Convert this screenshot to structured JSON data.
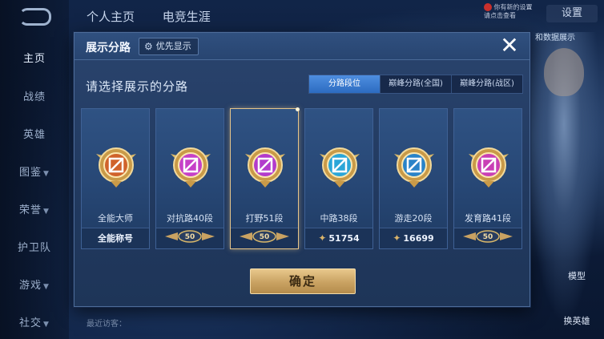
{
  "background": {
    "nav": [
      {
        "label": "主页",
        "active": true
      },
      {
        "label": "战绩",
        "active": false
      },
      {
        "label": "英雄",
        "active": false
      },
      {
        "label": "图鉴",
        "active": false
      },
      {
        "label": "荣誉",
        "active": false
      },
      {
        "label": "护卫队",
        "active": false
      },
      {
        "label": "游戏",
        "active": false
      },
      {
        "label": "社交",
        "active": false
      }
    ],
    "top_tabs": [
      "个人主页",
      "电竞生涯"
    ],
    "settings_label": "设置",
    "notice_text": "你有新的设置\n请点击查看",
    "top_right_hint": "和数据展示",
    "right_buttons": [
      "模型",
      "换英雄"
    ],
    "recent_visitors": "最近访客："
  },
  "modal": {
    "title": "展示分路",
    "priority_button": "优先显示",
    "subtitle": "请选择展示的分路",
    "segments": [
      {
        "label": "分路段位",
        "active": true
      },
      {
        "label": "巅峰分路(全国)",
        "active": false
      },
      {
        "label": "巅峰分路(战区)",
        "active": false
      }
    ],
    "cards": [
      {
        "label": "全能大师",
        "footer_type": "text",
        "footer": "全能称号",
        "emblem_color": "#d0622b",
        "emblem": "allround",
        "selected": false
      },
      {
        "label": "对抗路40段",
        "footer_type": "badge",
        "footer": "50",
        "emblem_color": "#c640c8",
        "emblem": "clash",
        "selected": false
      },
      {
        "label": "打野51段",
        "footer_type": "badge",
        "footer": "50",
        "emblem_color": "#b23bcc",
        "emblem": "jungle",
        "selected": true
      },
      {
        "label": "中路38段",
        "footer_type": "score",
        "footer": "51754",
        "emblem_color": "#2aa6d8",
        "emblem": "mid",
        "selected": false
      },
      {
        "label": "游走20段",
        "footer_type": "score",
        "footer": "16699",
        "emblem_color": "#2a83c8",
        "emblem": "roam",
        "selected": false
      },
      {
        "label": "发育路41段",
        "footer_type": "badge",
        "footer": "50",
        "emblem_color": "#c93fb5",
        "emblem": "farm",
        "selected": false
      }
    ],
    "confirm_button": "确定"
  },
  "colors": {
    "accent_gold": "#e6c58a",
    "segment_active": "#3b7dd6",
    "modal_bg": "#253f68"
  }
}
